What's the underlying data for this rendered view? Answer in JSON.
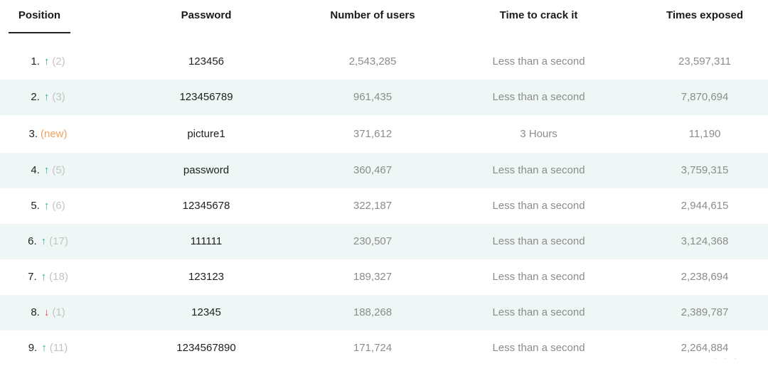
{
  "headers": {
    "position": "Position",
    "password": "Password",
    "users": "Number of users",
    "time": "Time to crack it",
    "exposed": "Times exposed"
  },
  "colors": {
    "up_arrow": "#3aa89a",
    "down_arrow": "#e04b4b",
    "new_tag": "#f4a25b",
    "row_shade": "#eef7f5"
  },
  "rows": [
    {
      "pos": "1.",
      "trend": "up",
      "prev": "(2)",
      "password": "123456",
      "users": "2,543,285",
      "time": "Less than a second",
      "exposed": "23,597,311"
    },
    {
      "pos": "2.",
      "trend": "up",
      "prev": "(3)",
      "password": "123456789",
      "users": "961,435",
      "time": "Less than a second",
      "exposed": "7,870,694"
    },
    {
      "pos": "3.",
      "trend": "new",
      "prev": "(new)",
      "password": "picture1",
      "users": "371,612",
      "time": "3 Hours",
      "exposed": "11,190"
    },
    {
      "pos": "4.",
      "trend": "up",
      "prev": "(5)",
      "password": "password",
      "users": "360,467",
      "time": "Less than a second",
      "exposed": "3,759,315"
    },
    {
      "pos": "5.",
      "trend": "up",
      "prev": "(6)",
      "password": "12345678",
      "users": "322,187",
      "time": "Less than a second",
      "exposed": "2,944,615"
    },
    {
      "pos": "6.",
      "trend": "up",
      "prev": "(17)",
      "password": "111111",
      "users": "230,507",
      "time": "Less than a second",
      "exposed": "3,124,368"
    },
    {
      "pos": "7.",
      "trend": "up",
      "prev": "(18)",
      "password": "123123",
      "users": "189,327",
      "time": "Less than a second",
      "exposed": "2,238,694"
    },
    {
      "pos": "8.",
      "trend": "down",
      "prev": "(1)",
      "password": "12345",
      "users": "188,268",
      "time": "Less than a second",
      "exposed": "2,389,787"
    },
    {
      "pos": "9.",
      "trend": "up",
      "prev": "(11)",
      "password": "1234567890",
      "users": "171,724",
      "time": "Less than a second",
      "exposed": "2,264,884"
    }
  ]
}
